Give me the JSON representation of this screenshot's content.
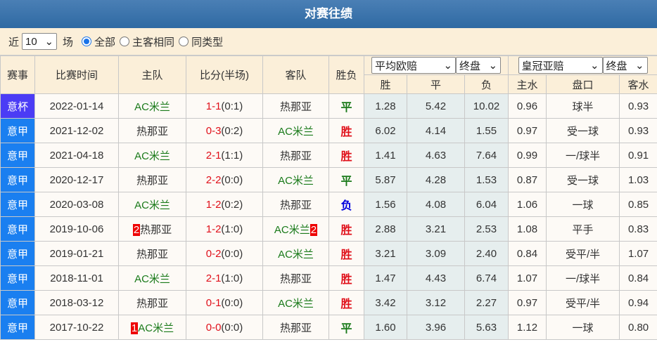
{
  "title": "对赛往绩",
  "filter": {
    "prefix": "近",
    "count": "10",
    "suffix": "场",
    "options": [
      "全部",
      "主客相同",
      "同类型"
    ],
    "selected": 0
  },
  "headers": {
    "league": "赛事",
    "time": "比赛时间",
    "home": "主队",
    "score": "比分(半场)",
    "away": "客队",
    "result": "胜负",
    "euro_select": "平均欧赔",
    "euro_stage": "终盘",
    "asia_select": "皇冠亚赔",
    "asia_stage": "终盘",
    "euro_cols": [
      "胜",
      "平",
      "负"
    ],
    "asia_cols": [
      "主水",
      "盘口",
      "客水"
    ]
  },
  "colors": {
    "cup": "#4b3cf5",
    "league": "#1a7ff0",
    "home_team_color": "#1a7a1a",
    "win": "#e0101a",
    "draw": "#1a7a1a",
    "loss": "#0000dd"
  },
  "rows": [
    {
      "league": "意杯",
      "cup": true,
      "date": "2022-01-14",
      "home": "AC米兰",
      "home_green": true,
      "home_badge": "",
      "score": "1-1",
      "half": "(0:1)",
      "away": "热那亚",
      "away_badge": "",
      "result": "平",
      "r": "draw",
      "w": "1.28",
      "d": "5.42",
      "l": "10.02",
      "hw": "0.96",
      "line": "球半",
      "aw": "0.93"
    },
    {
      "league": "意甲",
      "date": "2021-12-02",
      "home": "热那亚",
      "home_green": false,
      "home_badge": "",
      "score": "0-3",
      "half": "(0:2)",
      "away": "AC米兰",
      "away_badge": "",
      "result": "胜",
      "r": "win",
      "w": "6.02",
      "d": "4.14",
      "l": "1.55",
      "hw": "0.97",
      "line": "受一球",
      "aw": "0.93"
    },
    {
      "league": "意甲",
      "date": "2021-04-18",
      "home": "AC米兰",
      "home_green": true,
      "home_badge": "",
      "score": "2-1",
      "half": "(1:1)",
      "away": "热那亚",
      "away_badge": "",
      "result": "胜",
      "r": "win",
      "w": "1.41",
      "d": "4.63",
      "l": "7.64",
      "hw": "0.99",
      "line": "一/球半",
      "aw": "0.91"
    },
    {
      "league": "意甲",
      "date": "2020-12-17",
      "home": "热那亚",
      "home_green": false,
      "home_badge": "",
      "score": "2-2",
      "half": "(0:0)",
      "away": "AC米兰",
      "away_badge": "",
      "result": "平",
      "r": "draw",
      "w": "5.87",
      "d": "4.28",
      "l": "1.53",
      "hw": "0.87",
      "line": "受一球",
      "aw": "1.03"
    },
    {
      "league": "意甲",
      "date": "2020-03-08",
      "home": "AC米兰",
      "home_green": true,
      "home_badge": "",
      "score": "1-2",
      "half": "(0:2)",
      "away": "热那亚",
      "away_badge": "",
      "result": "负",
      "r": "loss",
      "w": "1.56",
      "d": "4.08",
      "l": "6.04",
      "hw": "1.06",
      "line": "一球",
      "aw": "0.85"
    },
    {
      "league": "意甲",
      "date": "2019-10-06",
      "home": "热那亚",
      "home_green": false,
      "home_badge": "2",
      "score": "1-2",
      "half": "(1:0)",
      "away": "AC米兰",
      "away_badge": "2",
      "result": "胜",
      "r": "win",
      "w": "2.88",
      "d": "3.21",
      "l": "2.53",
      "hw": "1.08",
      "line": "平手",
      "aw": "0.83"
    },
    {
      "league": "意甲",
      "date": "2019-01-21",
      "home": "热那亚",
      "home_green": false,
      "home_badge": "",
      "score": "0-2",
      "half": "(0:0)",
      "away": "AC米兰",
      "away_badge": "",
      "result": "胜",
      "r": "win",
      "w": "3.21",
      "d": "3.09",
      "l": "2.40",
      "hw": "0.84",
      "line": "受平/半",
      "aw": "1.07"
    },
    {
      "league": "意甲",
      "date": "2018-11-01",
      "home": "AC米兰",
      "home_green": true,
      "home_badge": "",
      "score": "2-1",
      "half": "(1:0)",
      "away": "热那亚",
      "away_badge": "",
      "result": "胜",
      "r": "win",
      "w": "1.47",
      "d": "4.43",
      "l": "6.74",
      "hw": "1.07",
      "line": "一/球半",
      "aw": "0.84"
    },
    {
      "league": "意甲",
      "date": "2018-03-12",
      "home": "热那亚",
      "home_green": false,
      "home_badge": "",
      "score": "0-1",
      "half": "(0:0)",
      "away": "AC米兰",
      "away_badge": "",
      "result": "胜",
      "r": "win",
      "w": "3.42",
      "d": "3.12",
      "l": "2.27",
      "hw": "0.97",
      "line": "受平/半",
      "aw": "0.94"
    },
    {
      "league": "意甲",
      "date": "2017-10-22",
      "home": "AC米兰",
      "home_green": true,
      "home_badge": "1",
      "score": "0-0",
      "half": "(0:0)",
      "away": "热那亚",
      "away_badge": "",
      "result": "平",
      "r": "draw",
      "w": "1.60",
      "d": "3.96",
      "l": "5.63",
      "hw": "1.12",
      "line": "一球",
      "aw": "0.80"
    }
  ]
}
